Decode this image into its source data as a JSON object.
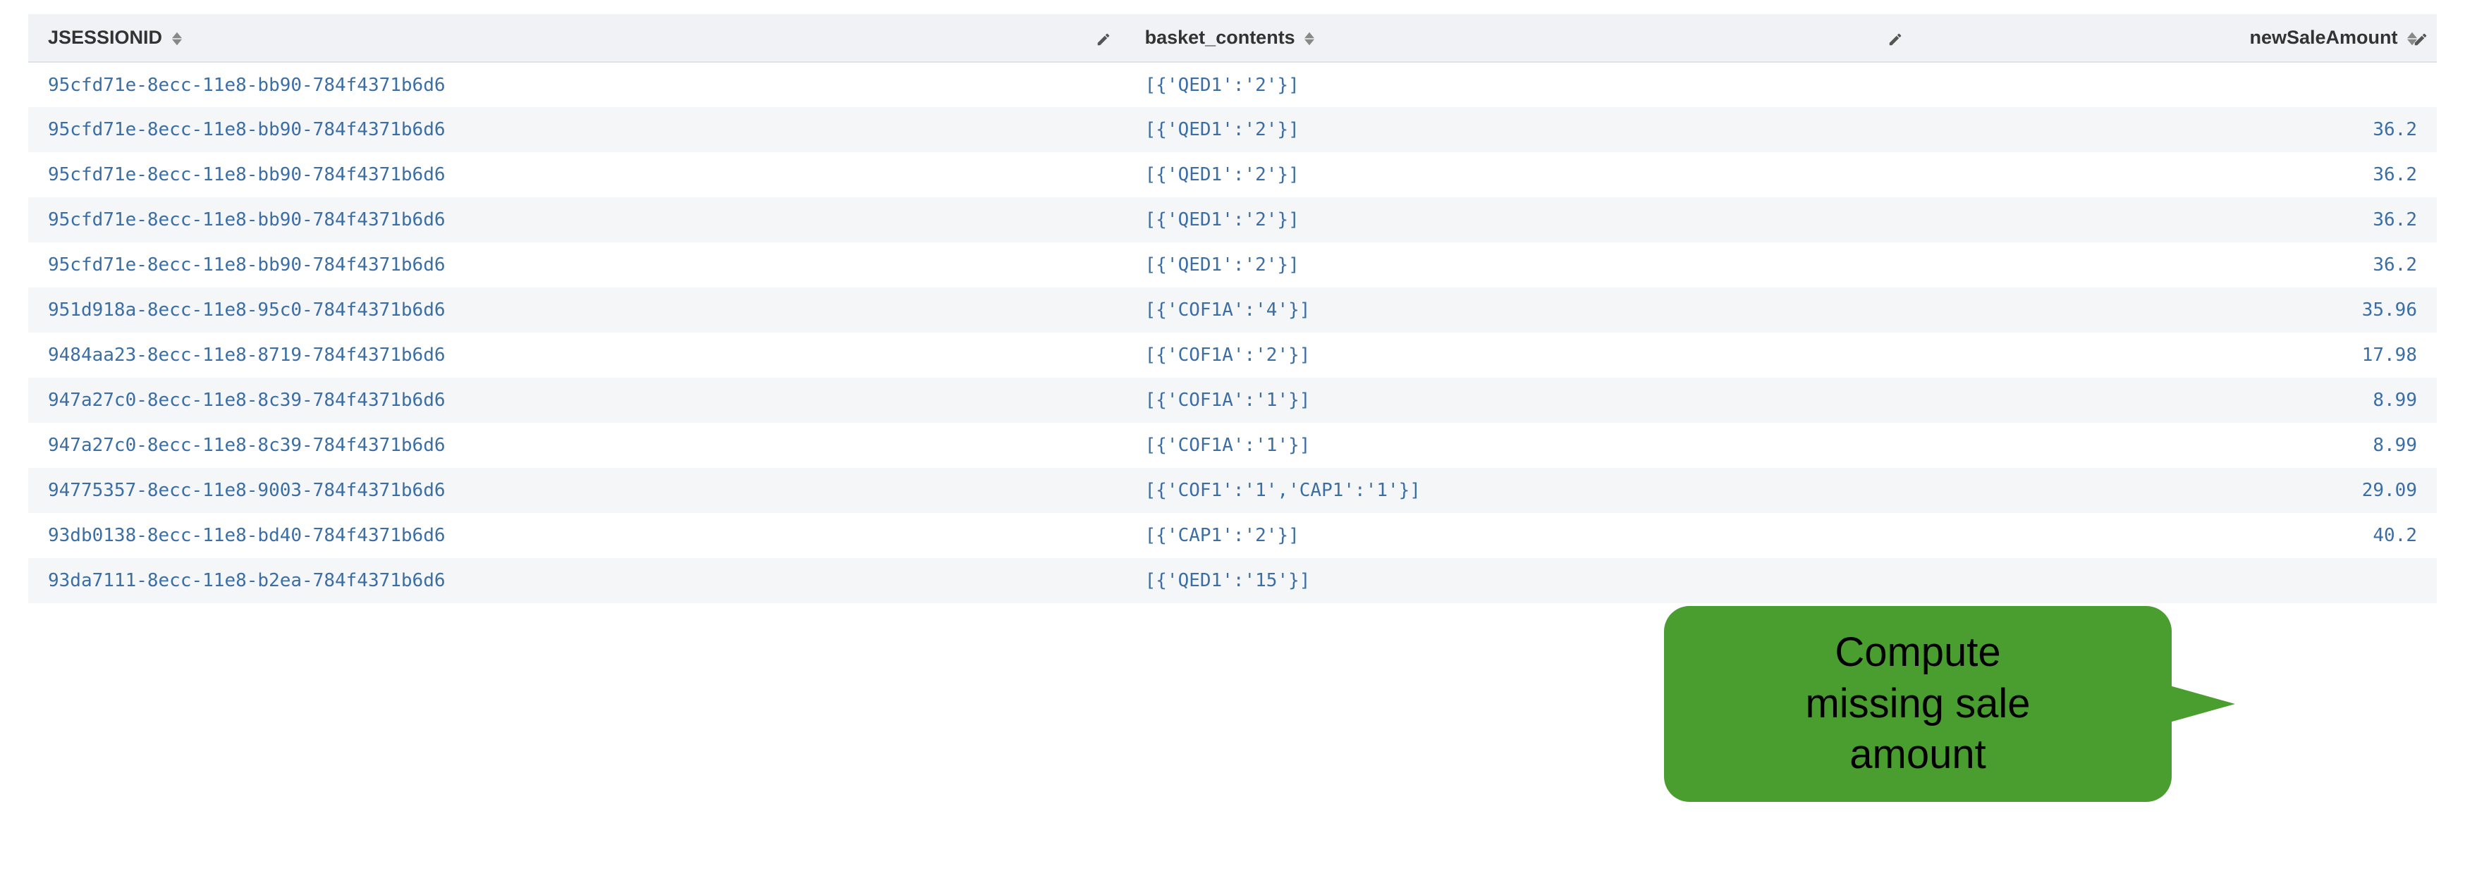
{
  "columns": {
    "jsessionid": {
      "label": "JSESSIONID"
    },
    "basket_contents": {
      "label": "basket_contents"
    },
    "newSaleAmount": {
      "label": "newSaleAmount"
    }
  },
  "rows": [
    {
      "jsessionid": "95cfd71e-8ecc-11e8-bb90-784f4371b6d6",
      "basket_contents": "[{'QED1':'2'}]",
      "newSaleAmount": ""
    },
    {
      "jsessionid": "95cfd71e-8ecc-11e8-bb90-784f4371b6d6",
      "basket_contents": "[{'QED1':'2'}]",
      "newSaleAmount": "36.2"
    },
    {
      "jsessionid": "95cfd71e-8ecc-11e8-bb90-784f4371b6d6",
      "basket_contents": "[{'QED1':'2'}]",
      "newSaleAmount": "36.2"
    },
    {
      "jsessionid": "95cfd71e-8ecc-11e8-bb90-784f4371b6d6",
      "basket_contents": "[{'QED1':'2'}]",
      "newSaleAmount": "36.2"
    },
    {
      "jsessionid": "95cfd71e-8ecc-11e8-bb90-784f4371b6d6",
      "basket_contents": "[{'QED1':'2'}]",
      "newSaleAmount": "36.2"
    },
    {
      "jsessionid": "951d918a-8ecc-11e8-95c0-784f4371b6d6",
      "basket_contents": "[{'COF1A':'4'}]",
      "newSaleAmount": "35.96"
    },
    {
      "jsessionid": "9484aa23-8ecc-11e8-8719-784f4371b6d6",
      "basket_contents": "[{'COF1A':'2'}]",
      "newSaleAmount": "17.98"
    },
    {
      "jsessionid": "947a27c0-8ecc-11e8-8c39-784f4371b6d6",
      "basket_contents": "[{'COF1A':'1'}]",
      "newSaleAmount": "8.99"
    },
    {
      "jsessionid": "947a27c0-8ecc-11e8-8c39-784f4371b6d6",
      "basket_contents": "[{'COF1A':'1'}]",
      "newSaleAmount": "8.99"
    },
    {
      "jsessionid": "94775357-8ecc-11e8-9003-784f4371b6d6",
      "basket_contents": "[{'COF1':'1','CAP1':'1'}]",
      "newSaleAmount": "29.09"
    },
    {
      "jsessionid": "93db0138-8ecc-11e8-bd40-784f4371b6d6",
      "basket_contents": "[{'CAP1':'2'}]",
      "newSaleAmount": "40.2"
    },
    {
      "jsessionid": "93da7111-8ecc-11e8-b2ea-784f4371b6d6",
      "basket_contents": "[{'QED1':'15'}]",
      "newSaleAmount": ""
    }
  ],
  "callout": {
    "line1": "Compute",
    "line2": "missing sale",
    "line3": "amount"
  }
}
